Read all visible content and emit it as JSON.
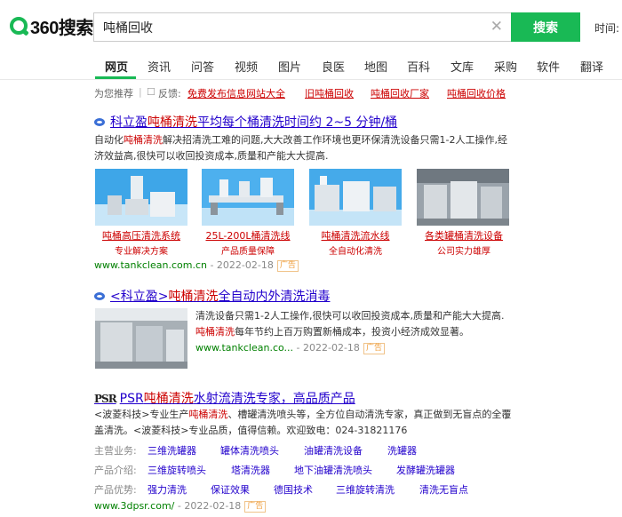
{
  "header": {
    "logo_text": "360搜索",
    "search_value": "吨桶回收",
    "search_button": "搜索",
    "time_filter": "时间: 不"
  },
  "nav": {
    "tabs": [
      "网页",
      "资讯",
      "问答",
      "视频",
      "图片",
      "良医",
      "地图",
      "百科",
      "文库",
      "采购",
      "软件",
      "翻译"
    ],
    "active_tab": "网页"
  },
  "related": {
    "label": "为您推荐",
    "feedback": "反馈:",
    "links": [
      "免费发布信息网站大全",
      "旧吨桶回收",
      "吨桶回收厂家",
      "吨桶回收价格"
    ]
  },
  "results": {
    "r1": {
      "title_pre": "科立盈",
      "title_hl": "吨桶清洗",
      "title_post": "平均每个桶清洗时间约 2~5 分钟/桶",
      "desc_pre": "自动化",
      "desc_hl": "吨桶清洗",
      "desc_post": "解决招清洗工难的问题,大大改善工作环境也更环保清洗设备只需1-2人工操作,经济效益高,很快可以收回投资成本,质量和产能大大提高.",
      "images": [
        {
          "caption": "吨桶高压清洗系统",
          "sub": "专业解决方案"
        },
        {
          "caption": "25L-200L桶清洗线",
          "sub": "产品质量保障"
        },
        {
          "caption": "吨桶清洗流水线",
          "sub": "全自动化清洗"
        },
        {
          "caption": "各类罐桶清洗设备",
          "sub": "公司实力雄厚"
        }
      ],
      "url": "www.tankclean.com.cn",
      "date": "- 2022-02-18",
      "ad": "广告"
    },
    "r2": {
      "title_pre": "<科立盈>",
      "title_hl": "吨桶清洗",
      "title_post": "全自动内外清洗消毒",
      "desc_line1": "清洗设备只需1-2人工操作,很快可以收回投资成本,质量和产能大大提高.",
      "desc_hl": "吨桶清洗",
      "desc_post": "每年节约上百万购置新桶成本，投资小经济成效显著。",
      "url": "www.tankclean.co...",
      "date": "- 2022-02-18",
      "ad": "广告"
    },
    "r3": {
      "logo": "PSR",
      "title_pre": "PSR",
      "title_hl": "吨桶清洗",
      "title_post": "水射流清洗专家，高品质产品",
      "desc_pre": "<波菱科技>专业生产",
      "desc_hl": "吨桶清洗",
      "desc_post": "、槽罐清洗喷头等，全方位自动清洗专家，真正做到无盲点的全覆盖清洗。<波菱科技>专业品质，值得信赖。欢迎致电：024-31821176",
      "rows": [
        {
          "label": "主营业务:",
          "links": [
            "三维洗罐器",
            "罐体清洗喷头",
            "油罐清洗设备",
            "洗罐器"
          ]
        },
        {
          "label": "产品介绍:",
          "links": [
            "三维旋转喷头",
            "塔清洗器",
            "地下油罐清洗喷头",
            "发酵罐洗罐器"
          ]
        },
        {
          "label": "产品优势:",
          "links": [
            "强力清洗",
            "保证效果",
            "德国技术",
            "三维旋转清洗",
            "清洗无盲点"
          ]
        }
      ],
      "url": "www.3dpsr.com/",
      "date": "- 2022-02-18",
      "ad": "广告"
    }
  },
  "colors": {
    "brand_green": "#19b955",
    "link_blue": "#2200cc",
    "highlight_red": "#cc0000",
    "url_green": "#008000"
  }
}
